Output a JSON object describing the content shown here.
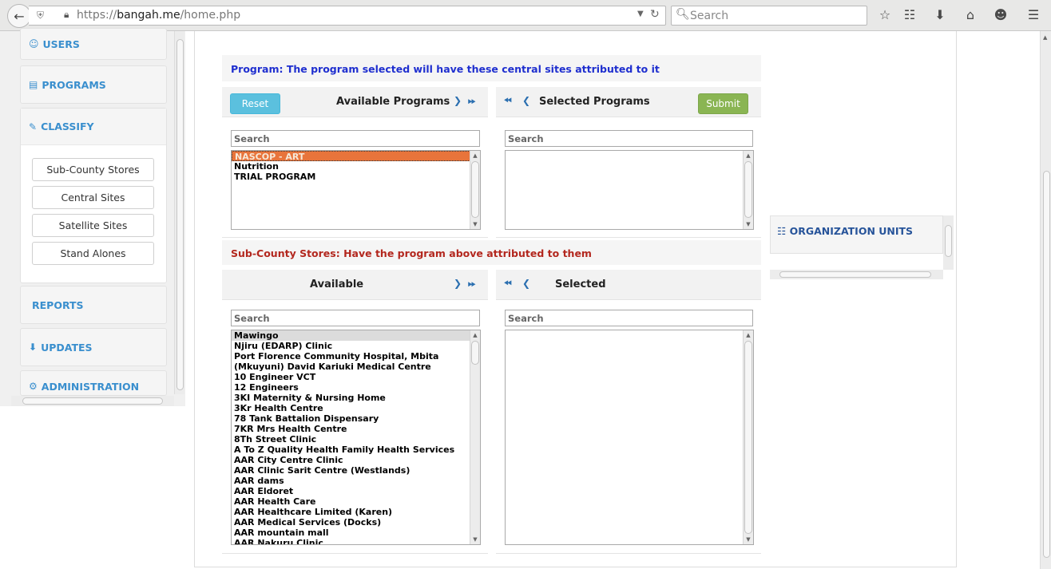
{
  "browser": {
    "url_prefix": "https://",
    "url_host": "bangah.me",
    "url_path": "/home.php",
    "search_placeholder": "Search"
  },
  "sidebar": {
    "users": "USERS",
    "programs": "PROGRAMS",
    "classify": "CLASSIFY",
    "classify_items": [
      "Sub-County Stores",
      "Central Sites",
      "Satellite Sites",
      "Stand Alones"
    ],
    "reports": "REPORTS",
    "updates": "UPDATES",
    "administration": "ADMINISTRATION"
  },
  "program_section": {
    "heading": "Program: The program selected will have these central sites attributed to it",
    "reset_label": "Reset",
    "available_title": "Available Programs",
    "selected_title": "Selected Programs",
    "submit_label": "Submit",
    "search_placeholder": "Search",
    "available_items": [
      "NASCOP - ART",
      "Nutrition",
      "TRIAL PROGRAM"
    ],
    "selected_items": []
  },
  "stores_section": {
    "heading": "Sub-County Stores: Have the program above attributed to them",
    "available_title": "Available",
    "selected_title": "Selected",
    "search_placeholder": "Search",
    "available_items": [
      "Mawingo",
      "Njiru (EDARP) Clinic",
      "Port Florence Community Hospital, Mbita",
      "(Mkuyuni) David Kariuki Medical Centre",
      "10 Engineer VCT",
      "12 Engineers",
      "3KI Maternity & Nursing Home",
      "3Kr Health Centre",
      "78 Tank Battalion Dispensary",
      "7KR Mrs Health Centre",
      "8Th Street Clinic",
      "A To Z Quality Health Family Health Services",
      "AAR City Centre Clinic",
      "AAR Clinic Sarit Centre (Westlands)",
      "AAR dams",
      "AAR Eldoret",
      "AAR Health Care",
      "AAR Healthcare Limited (Karen)",
      "AAR Medical Services (Docks)",
      "AAR mountain mall",
      "AAR Nakuru Clinic"
    ]
  },
  "org_units": {
    "title": "ORGANIZATION UNITS"
  }
}
